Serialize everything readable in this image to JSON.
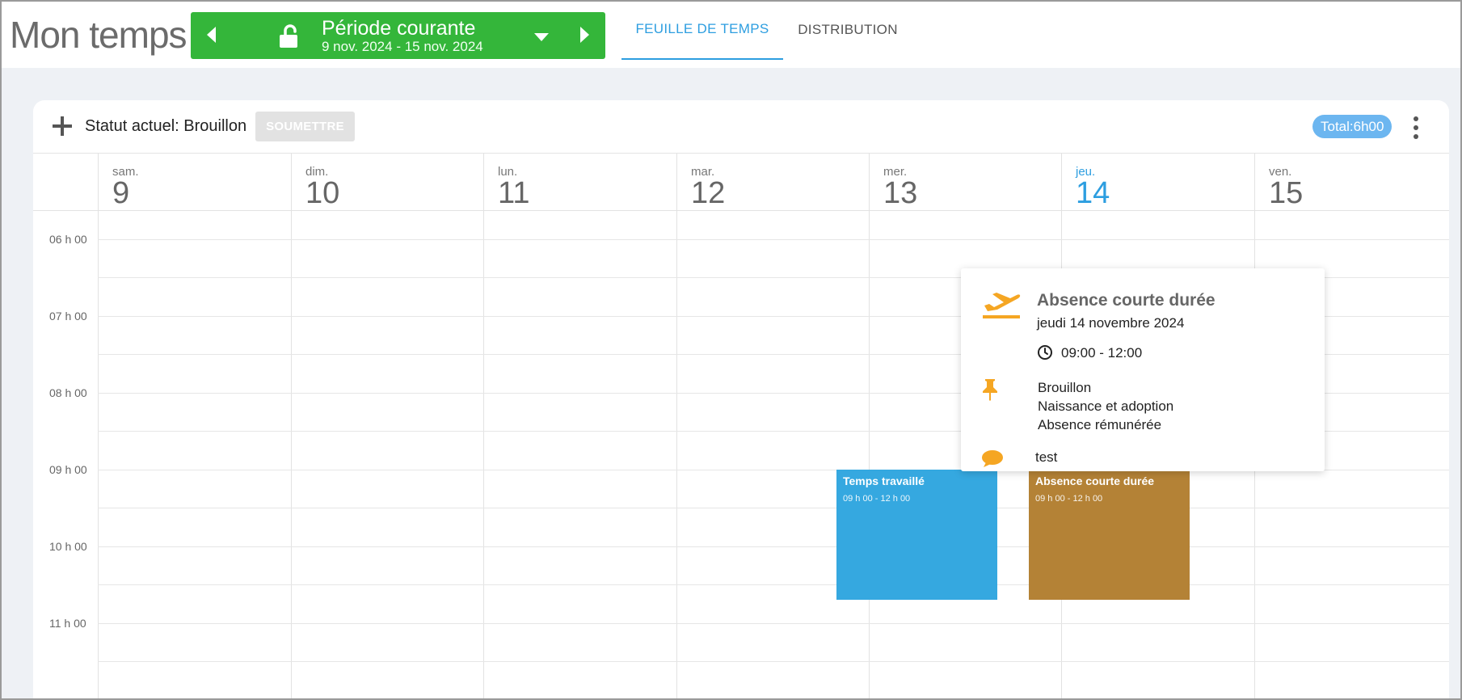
{
  "header": {
    "app_title": "Mon temps",
    "period": {
      "title": "Période courante",
      "range": "9 nov. 2024 - 15 nov. 2024",
      "prev_icon": "caret-left-icon",
      "next_icon": "caret-right-icon",
      "lock_icon": "unlock-icon",
      "dropdown_icon": "caret-down-icon",
      "color": "#34b63a"
    },
    "tabs": [
      {
        "label": "FEUILLE DE TEMPS",
        "active": true
      },
      {
        "label": "DISTRIBUTION",
        "active": false
      }
    ],
    "accent": "#2d9ee0"
  },
  "toolbar": {
    "add_icon": "plus-icon",
    "status_text": "Statut actuel: Brouillon",
    "submit_label": "SOUMETTRE",
    "total_label": "Total:6h00",
    "menu_icon": "more-vertical-icon"
  },
  "days": [
    {
      "name": "sam.",
      "num": "9"
    },
    {
      "name": "dim.",
      "num": "10"
    },
    {
      "name": "lun.",
      "num": "11"
    },
    {
      "name": "mar.",
      "num": "12"
    },
    {
      "name": "mer.",
      "num": "13"
    },
    {
      "name": "jeu.",
      "num": "14",
      "today": true
    },
    {
      "name": "ven.",
      "num": "15"
    }
  ],
  "hours": [
    "06 h 00",
    "07 h 00",
    "08 h 00",
    "09 h 00",
    "10 h 00",
    "11 h 00"
  ],
  "events": [
    {
      "title": "Temps travaillé",
      "time": "09 h 00 - 12 h 00",
      "day": "mer.",
      "color": "#35a8e0"
    },
    {
      "title": "Absence courte durée",
      "time": "09 h 00 - 12 h 00",
      "day": "jeu.",
      "color": "#b48236"
    }
  ],
  "popup": {
    "icon": "airplane-departure-icon",
    "title": "Absence courte durée",
    "date": "jeudi 14 novembre 2024",
    "clock_icon": "clock-icon",
    "time": "09:00 - 12:00",
    "pin_icon": "pin-icon",
    "lines": [
      "Brouillon",
      "Naissance et adoption",
      "Absence rémunérée"
    ],
    "comment_icon": "comment-icon",
    "comment": "test",
    "icon_color": "#f5a623"
  }
}
